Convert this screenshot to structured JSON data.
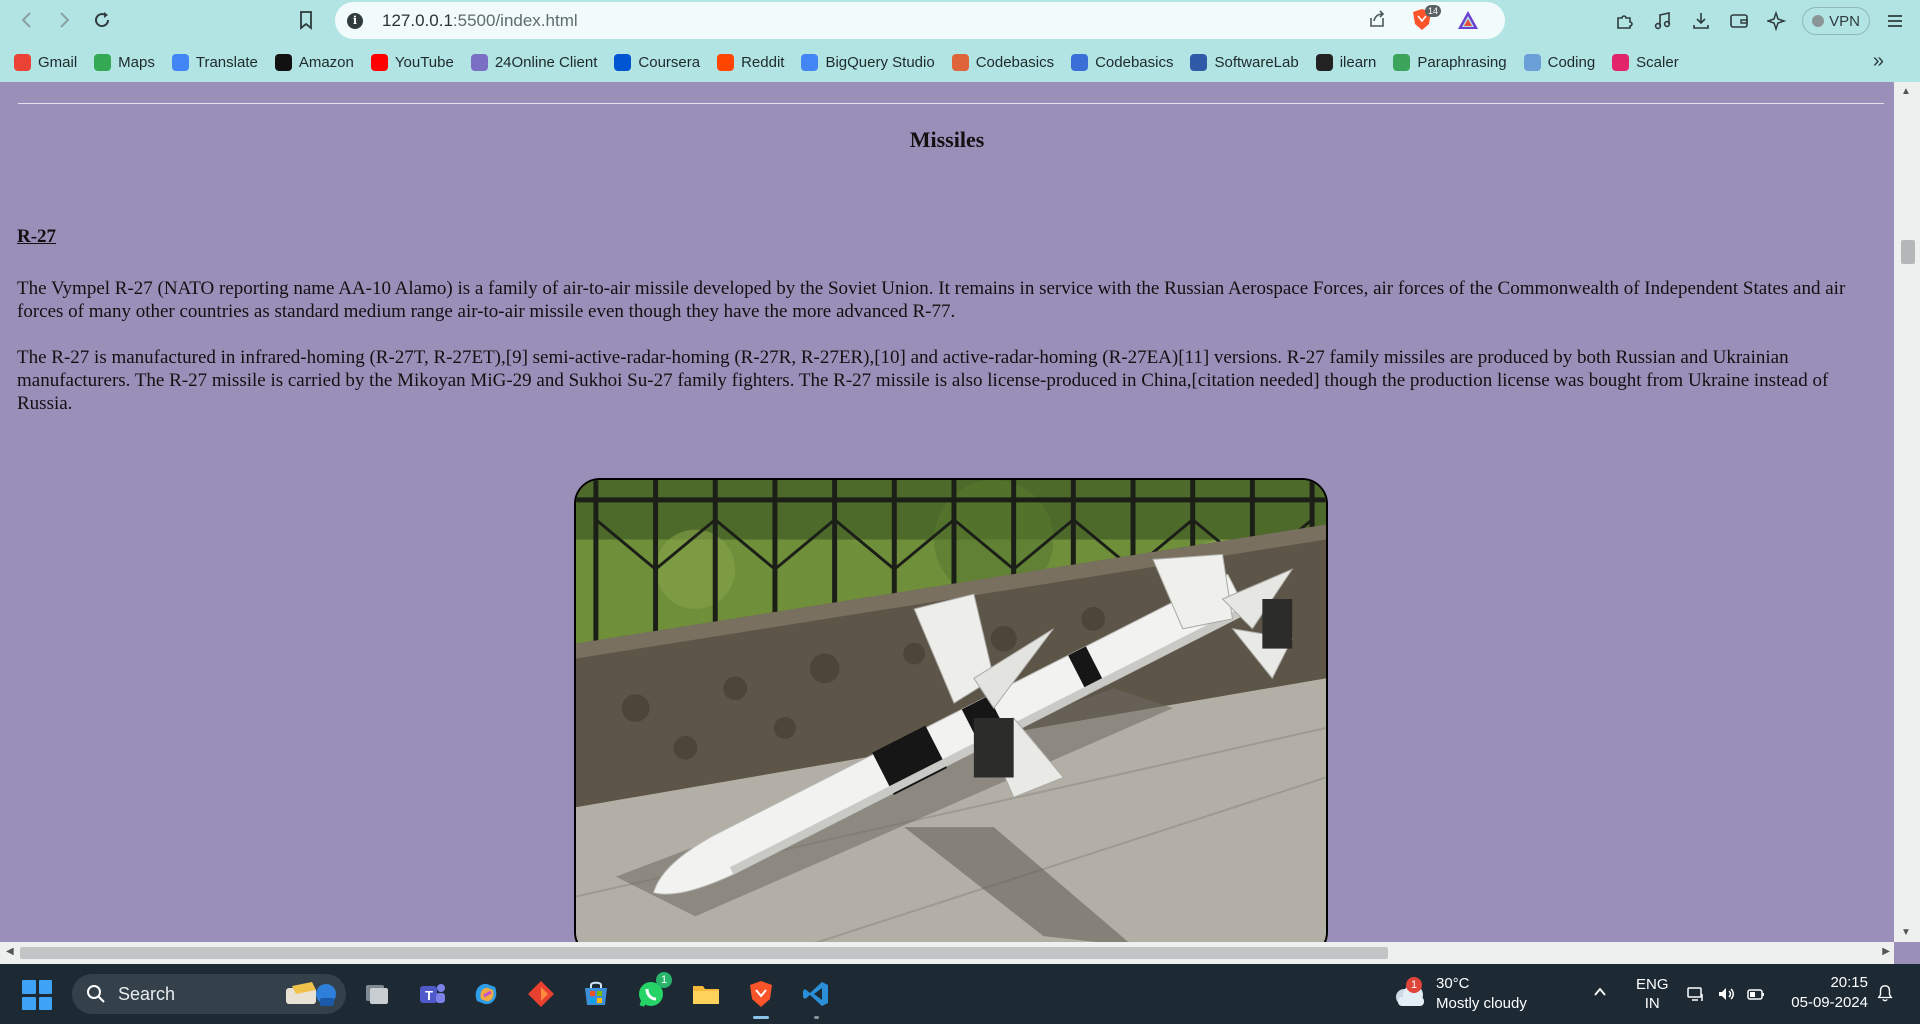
{
  "browser": {
    "url_host": "127.0.0.1",
    "url_path": ":5500/index.html",
    "shield_badge": "14",
    "vpn_label": "VPN"
  },
  "bookmarks": [
    {
      "label": "Gmail",
      "icon": "gmail-icon",
      "color": "#ea4335"
    },
    {
      "label": "Maps",
      "icon": "maps-pin-icon",
      "color": "#34a853"
    },
    {
      "label": "Translate",
      "icon": "translate-icon",
      "color": "#4285f4"
    },
    {
      "label": "Amazon",
      "icon": "amazon-icon",
      "color": "#111111"
    },
    {
      "label": "YouTube",
      "icon": "youtube-icon",
      "color": "#ff0000"
    },
    {
      "label": "24Online Client",
      "icon": "24online-icon",
      "color": "#7b6fc4"
    },
    {
      "label": "Coursera",
      "icon": "coursera-icon",
      "color": "#0056d2"
    },
    {
      "label": "Reddit",
      "icon": "reddit-icon",
      "color": "#ff4500"
    },
    {
      "label": "BigQuery Studio",
      "icon": "bigquery-icon",
      "color": "#4285f4"
    },
    {
      "label": "Codebasics",
      "icon": "rocket-icon",
      "color": "#e0643a"
    },
    {
      "label": "Codebasics",
      "icon": "codebasics-icon",
      "color": "#3a6fd8"
    },
    {
      "label": "SoftwareLab",
      "icon": "softwarelab-icon",
      "color": "#2f5aa8"
    },
    {
      "label": "ilearn",
      "icon": "globe-icon",
      "color": "#222222"
    },
    {
      "label": "Paraphrasing",
      "icon": "paraphrasing-icon",
      "color": "#3aa55a"
    },
    {
      "label": "Coding",
      "icon": "coding-icon",
      "color": "#6a9fd8"
    },
    {
      "label": "Scaler",
      "icon": "scaler-icon",
      "color": "#e2246a"
    }
  ],
  "page": {
    "title": "Missiles",
    "section_heading": "R-27",
    "paragraph1": "The Vympel R-27 (NATO reporting name AA-10 Alamo) is a family of air-to-air missile developed by the Soviet Union. It remains in service with the Russian Aerospace Forces, air forces of the Commonwealth of Independent States and air forces of many other countries as standard medium range air-to-air missile even though they have the more advanced R-77.",
    "paragraph2": "The R-27 is manufactured in infrared-homing (R-27T, R-27ET),[9] semi-active-radar-homing (R-27R, R-27ER),[10] and active-radar-homing (R-27EA)[11] versions. R-27 family missiles are produced by both Russian and Ukrainian manufacturers. The R-27 missile is carried by the Mikoyan MiG-29 and Sukhoi Su-27 family fighters. The R-27 missile is also license-produced in China,[citation needed] though the production license was bought from Ukraine instead of Russia.",
    "background_color": "#9a8fb9"
  },
  "taskbar": {
    "search_label": "Search",
    "whatsapp_badge": "1",
    "weather_badge": "1",
    "temperature": "30°C",
    "weather_desc": "Mostly cloudy",
    "lang_line1": "ENG",
    "lang_line2": "IN",
    "time": "20:15",
    "date": "05-09-2024"
  }
}
